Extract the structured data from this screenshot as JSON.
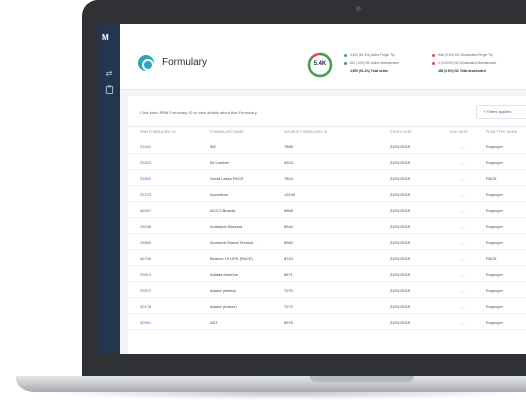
{
  "app": {
    "logo_text": "M",
    "nav_icons": [
      "swap-icon",
      "clipboard-icon"
    ]
  },
  "header": {
    "title": "Formulary",
    "donut": {
      "label": "5.4K",
      "fraction": 0.86,
      "color_primary": "#3aa655",
      "color_secondary": "#e0455a"
    },
    "stats": [
      {
        "color": "#3aa655",
        "text": "4,400 (81.4%) Active Finger Tip"
      },
      {
        "color": "#3aa655",
        "text": "810 (10%) NC Active Manufacturer"
      },
      {
        "color": null,
        "text": "4,500 (91.4%) Total active",
        "total": true
      },
      {
        "color": "#e0455a",
        "text": "HAe (9.6%) NC Deactivated Finger Tip"
      },
      {
        "color": "#e0455a",
        "text": "4 (0.004%) NC Deactivated Manufacturer"
      },
      {
        "color": null,
        "text": "458 (9.6%) NC Total deactivated",
        "total": true
      }
    ]
  },
  "table": {
    "hint": "Click each PBM Formulary ID to view details about that Formulary.",
    "filters_label": "+ Filters applied",
    "columns": [
      "PBM Formulary ID",
      "Formulary Name",
      "Source Formulary ID",
      "Start Date",
      "End Date",
      "Plan Type Name"
    ],
    "rows": [
      {
        "id": "23441",
        "name": "3M",
        "source": "7865",
        "start": "01/01/2019",
        "end": "—",
        "plan": "Employer"
      },
      {
        "id": "25423",
        "name": "84 Lumber",
        "source": "9323",
        "start": "01/01/2019",
        "end": "—",
        "plan": "Employer"
      },
      {
        "id": "33509",
        "name": "Great Lakes PACE",
        "source": "7824",
        "start": "01/01/2019",
        "end": "—",
        "plan": "PACE"
      },
      {
        "id": "25723",
        "name": "Accenture",
        "source": "13190",
        "start": "01/01/2019",
        "end": "—",
        "plan": "Employer"
      },
      {
        "id": "36557",
        "name": "ACCO Brands",
        "source": "9868",
        "start": "01/01/2019",
        "end": "—",
        "plan": "Employer"
      },
      {
        "id": "28548",
        "name": "Activision Blizzard",
        "source": "8544",
        "start": "01/01/2019",
        "end": "—",
        "plan": "Employer"
      },
      {
        "id": "28855",
        "name": "Acument Global Technol...",
        "source": "8562",
        "start": "01/01/2019",
        "end": "—",
        "plan": "Employer"
      },
      {
        "id": "36768",
        "name": "Beacon Of LIFE (PACE)",
        "source": "8724",
        "start": "01/01/2019",
        "end": "—",
        "plan": "PACE"
      },
      {
        "id": "29610",
        "name": "Adidas America",
        "source": "8671",
        "start": "01/01/2019",
        "end": "—",
        "plan": "Employer"
      },
      {
        "id": "29972",
        "name": "Adobe (Aetna)",
        "source": "7270",
        "start": "01/01/2019",
        "end": "—",
        "plan": "Employer"
      },
      {
        "id": "30178",
        "name": "Adobe (Kaiser)",
        "source": "7272",
        "start": "01/01/2019",
        "end": "—",
        "plan": "Employer"
      },
      {
        "id": "30991",
        "name": "ADT",
        "source": "8576",
        "start": "01/01/2019",
        "end": "—",
        "plan": "Employer"
      }
    ]
  }
}
